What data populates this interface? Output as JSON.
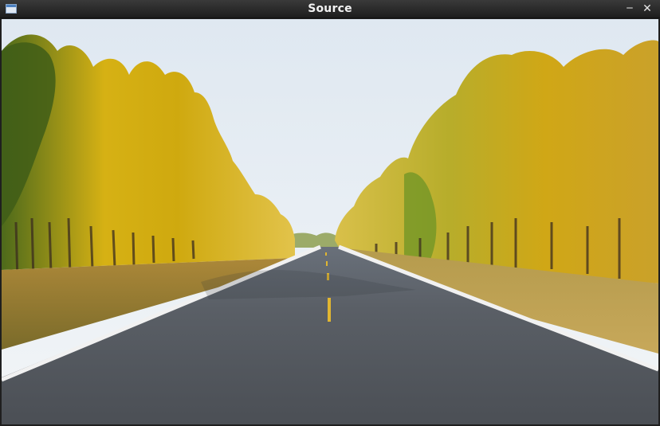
{
  "window": {
    "title": "Source",
    "icons": {
      "app": "app-window-icon",
      "minimize": "minimize-icon",
      "close": "close-icon"
    }
  },
  "image": {
    "description_colors": {
      "sky_top": "#dfe8f1",
      "sky_bottom": "#f2f5f7",
      "asphalt": "#5f6368",
      "lane_line": "#f1f1f1",
      "center_line": "#e1b631",
      "foliage_yellow": "#d9b21b",
      "foliage_green": "#8a9b1f"
    }
  }
}
